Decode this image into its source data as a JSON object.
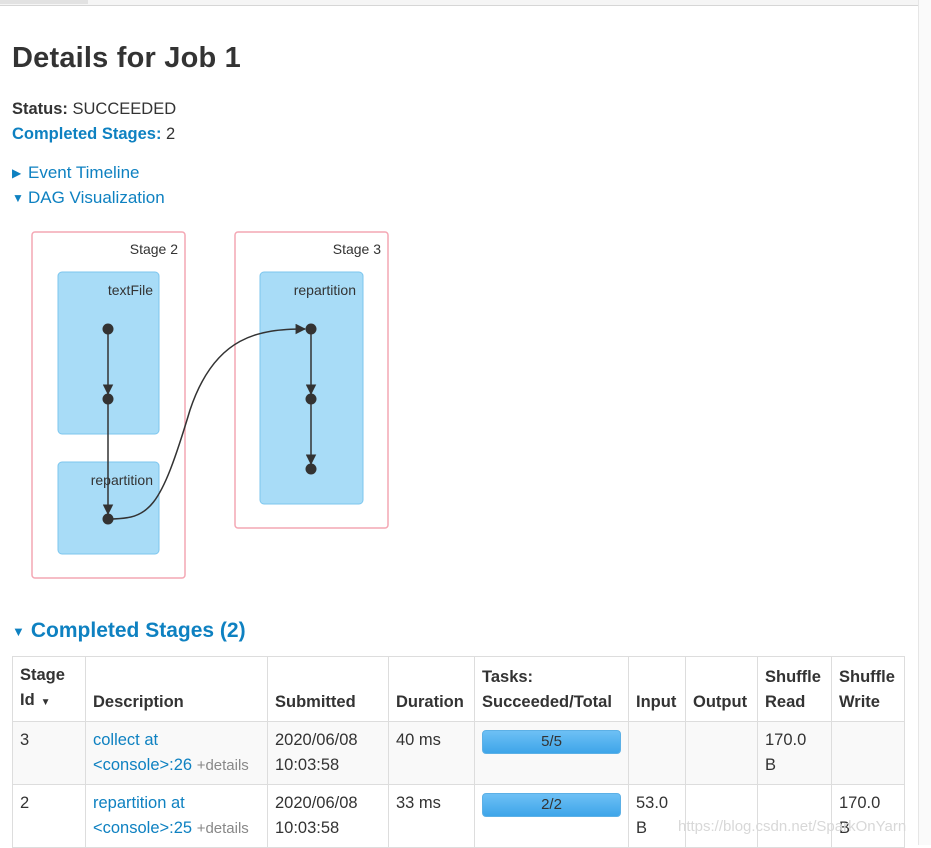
{
  "page": {
    "title": "Details for Job 1",
    "status_label": "Status:",
    "status_value": "SUCCEEDED",
    "completed_label": "Completed Stages:",
    "completed_value": "2",
    "event_timeline": "Event Timeline",
    "dag_visualization": "DAG Visualization"
  },
  "dag": {
    "stages": [
      {
        "label": "Stage 2",
        "ops": [
          "textFile",
          "repartition"
        ]
      },
      {
        "label": "Stage 3",
        "ops": [
          "repartition"
        ]
      }
    ]
  },
  "completed_section": {
    "title": "Completed Stages (2)",
    "columns": {
      "stage_id_1": "Stage",
      "stage_id_2": "Id",
      "description": "Description",
      "submitted": "Submitted",
      "duration": "Duration",
      "tasks_1": "Tasks:",
      "tasks_2": "Succeeded/Total",
      "input": "Input",
      "output": "Output",
      "shuffle_read_1": "Shuffle",
      "shuffle_read_2": "Read",
      "shuffle_write_1": "Shuffle",
      "shuffle_write_2": "Write"
    },
    "rows": [
      {
        "id": "3",
        "desc_1": "collect at",
        "desc_2": "<console>:26",
        "details": "+details",
        "submitted_1": "2020/06/08",
        "submitted_2": "10:03:58",
        "duration": "40 ms",
        "tasks": "5/5",
        "tasks_fraction": 1.0,
        "input_1": "",
        "input_2": "",
        "output": "",
        "shuffle_read_1": "170.0",
        "shuffle_read_2": "B",
        "shuffle_write_1": "",
        "shuffle_write_2": ""
      },
      {
        "id": "2",
        "desc_1": "repartition at",
        "desc_2": "<console>:25",
        "details": "+details",
        "submitted_1": "2020/06/08",
        "submitted_2": "10:03:58",
        "duration": "33 ms",
        "tasks": "2/2",
        "tasks_fraction": 1.0,
        "input_1": "53.0",
        "input_2": "B",
        "output": "",
        "shuffle_read_1": "",
        "shuffle_read_2": "",
        "shuffle_write_1": "170.0",
        "shuffle_write_2": "B"
      }
    ]
  },
  "watermark": "https://blog.csdn.net/SparkOnYarn",
  "colors": {
    "link": "#0e81c1",
    "stage_border": "#f4a7b4",
    "op_fill": "#a8dcf7",
    "op_border": "#7cc6ee",
    "progress": "#4aaeec"
  }
}
